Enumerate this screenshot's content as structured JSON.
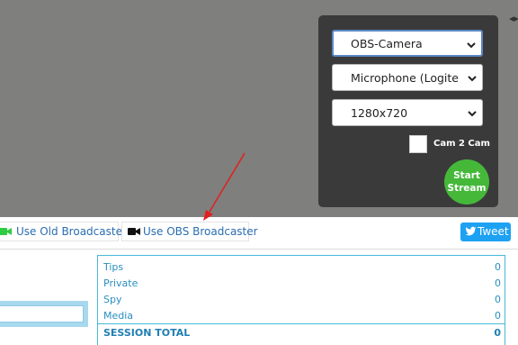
{
  "devices": {
    "camera": "OBS-Camera",
    "microphone": "Microphone (Logitech",
    "resolution": "1280x720"
  },
  "cam2cam_label": "Cam 2 Cam",
  "start_button": [
    "Start",
    "Stream"
  ],
  "broadcaster": {
    "old_label": "Use Old Broadcaster",
    "obs_label": "Use OBS Broadcaster"
  },
  "tweet_label": "Tweet",
  "stats": [
    {
      "label": "Tips",
      "value": "0"
    },
    {
      "label": "Private",
      "value": "0"
    },
    {
      "label": "Spy",
      "value": "0"
    },
    {
      "label": "Media",
      "value": "0"
    }
  ],
  "session_total": {
    "label": "SESSION TOTAL",
    "value": "0"
  },
  "colors": {
    "accent_blue": "#2a6db0",
    "start_green": "#45b83a",
    "annotation_red": "#e02020",
    "tweet_blue": "#1da1f2"
  }
}
